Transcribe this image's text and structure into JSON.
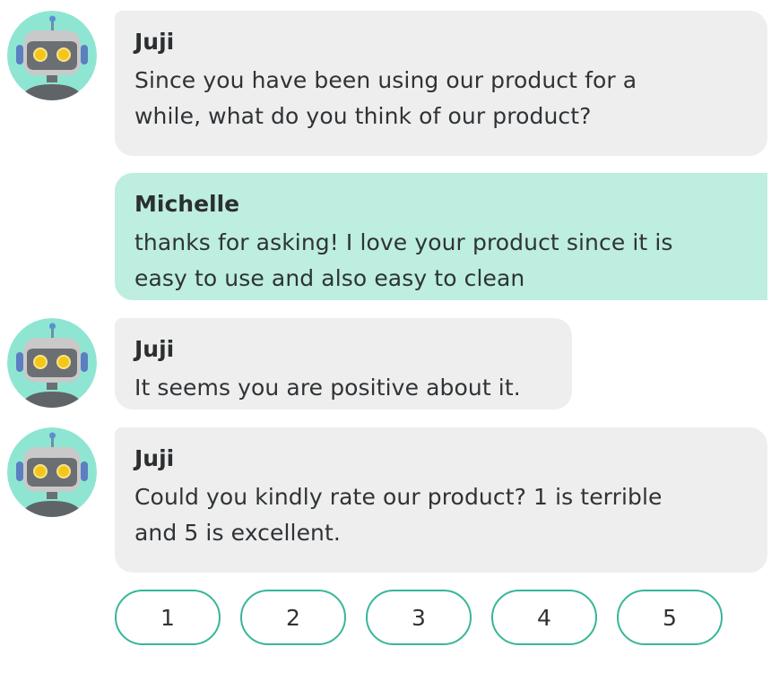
{
  "colors": {
    "bot_bubble": "#eeeeee",
    "user_bubble": "#bdeee0",
    "accent": "#36b698",
    "avatar_bg": "#8ee6d2"
  },
  "messages": [
    {
      "sender": "Juji",
      "text_lines": [
        "Since you have been using our product for a",
        "while, what do you think of our product?"
      ],
      "role": "bot",
      "avatar_icon": "robot-avatar-icon"
    },
    {
      "sender": "Michelle",
      "text_lines": [
        "thanks for asking! I love your product since it is",
        "easy to use and also easy to clean"
      ],
      "role": "user"
    },
    {
      "sender": "Juji",
      "text_lines": [
        "It seems you are positive about it."
      ],
      "role": "bot",
      "avatar_icon": "robot-avatar-icon"
    },
    {
      "sender": "Juji",
      "text_lines": [
        "Could you kindly rate our product? 1 is terrible",
        "and 5 is excellent."
      ],
      "role": "bot",
      "avatar_icon": "robot-avatar-icon"
    }
  ],
  "rating_options": [
    "1",
    "2",
    "3",
    "4",
    "5"
  ]
}
